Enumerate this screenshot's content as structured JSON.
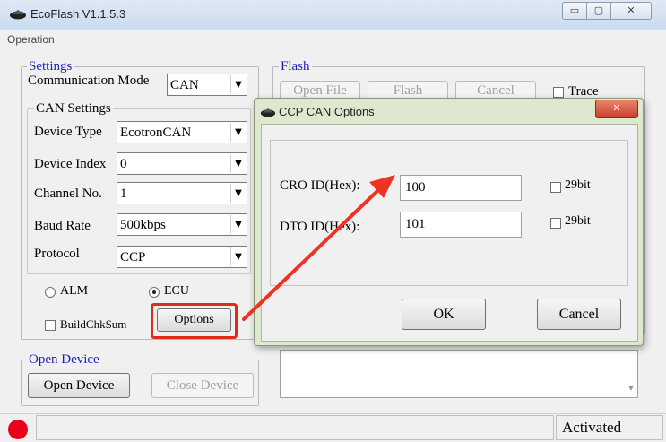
{
  "window": {
    "title": "EcoFlash V1.1.5.3",
    "controls": {
      "minimize": "▭",
      "maximize": "▢",
      "close": "✕"
    }
  },
  "menu": {
    "operation": "Operation"
  },
  "settings": {
    "legend": "Settings",
    "comm_mode_label": "Communication Mode",
    "comm_mode_value": "CAN",
    "can_settings_legend": "CAN Settings",
    "device_type_label": "Device Type",
    "device_type_value": "EcotronCAN",
    "device_index_label": "Device Index",
    "device_index_value": "0",
    "channel_label": "Channel No.",
    "channel_value": "1",
    "baud_label": "Baud Rate",
    "baud_value": "500kbps",
    "protocol_label": "Protocol",
    "protocol_value": "CCP",
    "radio_alm": "ALM",
    "radio_ecu": "ECU",
    "selected_mode": "ECU",
    "buildchksum_label": "BuildChkSum",
    "options_button": "Options"
  },
  "flash": {
    "legend": "Flash",
    "open_file_button": "Open File",
    "flash_button": "Flash",
    "cancel_button": "Cancel",
    "trace_label": "Trace"
  },
  "open_device": {
    "legend": "Open Device",
    "open_button": "Open Device",
    "close_button": "Close Device"
  },
  "status": {
    "text": "Activated",
    "indicator_color": "#e8001c"
  },
  "dialog": {
    "title": "CCP CAN Options",
    "close": "✕",
    "cro_label": "CRO ID(Hex):",
    "cro_value": "100",
    "cro_29bit_label": "29bit",
    "dto_label": "DTO ID(Hex):",
    "dto_value": "101",
    "dto_29bit_label": "29bit",
    "ok_button": "OK",
    "cancel_button": "Cancel"
  },
  "annotation": {
    "color": "#e02a1a",
    "arrow_color": "#ee3322"
  }
}
